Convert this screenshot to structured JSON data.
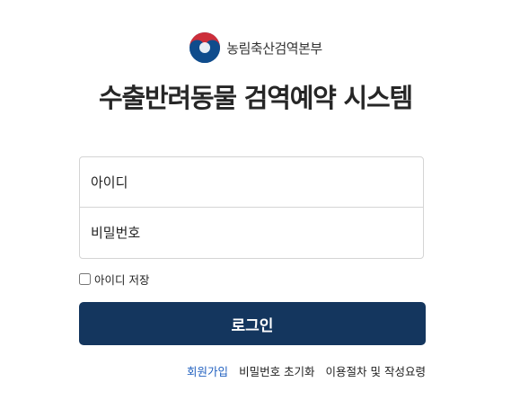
{
  "header": {
    "agency_name": "농림축산검역본부",
    "system_title": "수출반려동물 검역예약 시스템",
    "emblem_icon": "taegeuk-emblem-icon"
  },
  "login_form": {
    "id_placeholder": "아이디",
    "password_placeholder": "비밀번호",
    "remember_label": "아이디 저장",
    "remember_checked": false,
    "submit_label": "로그인"
  },
  "footer_links": {
    "signup": "회원가입",
    "reset_password": "비밀번호 초기화",
    "guide": "이용절차 및 작성요령"
  },
  "colors": {
    "button_bg": "#14365e",
    "link_primary": "#1f5fbf",
    "emblem_red": "#cd2e3a",
    "emblem_blue": "#0f4c8c"
  }
}
